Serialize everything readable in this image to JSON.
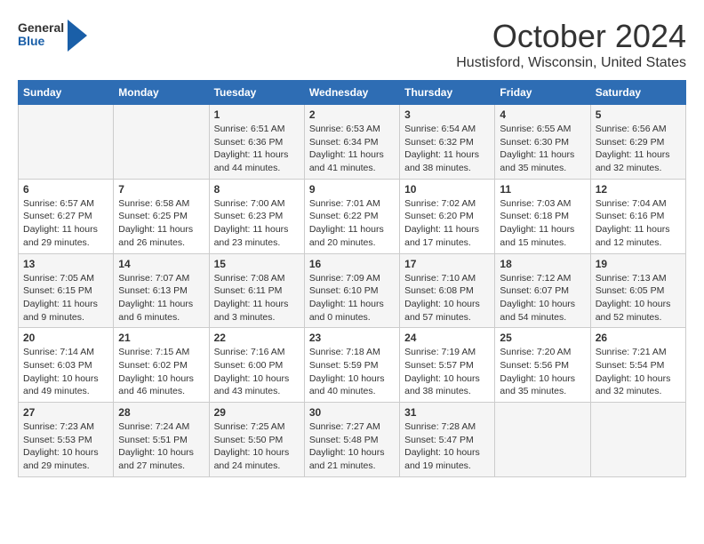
{
  "header": {
    "logo_general": "General",
    "logo_blue": "Blue",
    "title": "October 2024",
    "location": "Hustisford, Wisconsin, United States"
  },
  "days_of_week": [
    "Sunday",
    "Monday",
    "Tuesday",
    "Wednesday",
    "Thursday",
    "Friday",
    "Saturday"
  ],
  "weeks": [
    [
      {
        "num": "",
        "content": ""
      },
      {
        "num": "",
        "content": ""
      },
      {
        "num": "1",
        "content": "Sunrise: 6:51 AM\nSunset: 6:36 PM\nDaylight: 11 hours and 44 minutes."
      },
      {
        "num": "2",
        "content": "Sunrise: 6:53 AM\nSunset: 6:34 PM\nDaylight: 11 hours and 41 minutes."
      },
      {
        "num": "3",
        "content": "Sunrise: 6:54 AM\nSunset: 6:32 PM\nDaylight: 11 hours and 38 minutes."
      },
      {
        "num": "4",
        "content": "Sunrise: 6:55 AM\nSunset: 6:30 PM\nDaylight: 11 hours and 35 minutes."
      },
      {
        "num": "5",
        "content": "Sunrise: 6:56 AM\nSunset: 6:29 PM\nDaylight: 11 hours and 32 minutes."
      }
    ],
    [
      {
        "num": "6",
        "content": "Sunrise: 6:57 AM\nSunset: 6:27 PM\nDaylight: 11 hours and 29 minutes."
      },
      {
        "num": "7",
        "content": "Sunrise: 6:58 AM\nSunset: 6:25 PM\nDaylight: 11 hours and 26 minutes."
      },
      {
        "num": "8",
        "content": "Sunrise: 7:00 AM\nSunset: 6:23 PM\nDaylight: 11 hours and 23 minutes."
      },
      {
        "num": "9",
        "content": "Sunrise: 7:01 AM\nSunset: 6:22 PM\nDaylight: 11 hours and 20 minutes."
      },
      {
        "num": "10",
        "content": "Sunrise: 7:02 AM\nSunset: 6:20 PM\nDaylight: 11 hours and 17 minutes."
      },
      {
        "num": "11",
        "content": "Sunrise: 7:03 AM\nSunset: 6:18 PM\nDaylight: 11 hours and 15 minutes."
      },
      {
        "num": "12",
        "content": "Sunrise: 7:04 AM\nSunset: 6:16 PM\nDaylight: 11 hours and 12 minutes."
      }
    ],
    [
      {
        "num": "13",
        "content": "Sunrise: 7:05 AM\nSunset: 6:15 PM\nDaylight: 11 hours and 9 minutes."
      },
      {
        "num": "14",
        "content": "Sunrise: 7:07 AM\nSunset: 6:13 PM\nDaylight: 11 hours and 6 minutes."
      },
      {
        "num": "15",
        "content": "Sunrise: 7:08 AM\nSunset: 6:11 PM\nDaylight: 11 hours and 3 minutes."
      },
      {
        "num": "16",
        "content": "Sunrise: 7:09 AM\nSunset: 6:10 PM\nDaylight: 11 hours and 0 minutes."
      },
      {
        "num": "17",
        "content": "Sunrise: 7:10 AM\nSunset: 6:08 PM\nDaylight: 10 hours and 57 minutes."
      },
      {
        "num": "18",
        "content": "Sunrise: 7:12 AM\nSunset: 6:07 PM\nDaylight: 10 hours and 54 minutes."
      },
      {
        "num": "19",
        "content": "Sunrise: 7:13 AM\nSunset: 6:05 PM\nDaylight: 10 hours and 52 minutes."
      }
    ],
    [
      {
        "num": "20",
        "content": "Sunrise: 7:14 AM\nSunset: 6:03 PM\nDaylight: 10 hours and 49 minutes."
      },
      {
        "num": "21",
        "content": "Sunrise: 7:15 AM\nSunset: 6:02 PM\nDaylight: 10 hours and 46 minutes."
      },
      {
        "num": "22",
        "content": "Sunrise: 7:16 AM\nSunset: 6:00 PM\nDaylight: 10 hours and 43 minutes."
      },
      {
        "num": "23",
        "content": "Sunrise: 7:18 AM\nSunset: 5:59 PM\nDaylight: 10 hours and 40 minutes."
      },
      {
        "num": "24",
        "content": "Sunrise: 7:19 AM\nSunset: 5:57 PM\nDaylight: 10 hours and 38 minutes."
      },
      {
        "num": "25",
        "content": "Sunrise: 7:20 AM\nSunset: 5:56 PM\nDaylight: 10 hours and 35 minutes."
      },
      {
        "num": "26",
        "content": "Sunrise: 7:21 AM\nSunset: 5:54 PM\nDaylight: 10 hours and 32 minutes."
      }
    ],
    [
      {
        "num": "27",
        "content": "Sunrise: 7:23 AM\nSunset: 5:53 PM\nDaylight: 10 hours and 29 minutes."
      },
      {
        "num": "28",
        "content": "Sunrise: 7:24 AM\nSunset: 5:51 PM\nDaylight: 10 hours and 27 minutes."
      },
      {
        "num": "29",
        "content": "Sunrise: 7:25 AM\nSunset: 5:50 PM\nDaylight: 10 hours and 24 minutes."
      },
      {
        "num": "30",
        "content": "Sunrise: 7:27 AM\nSunset: 5:48 PM\nDaylight: 10 hours and 21 minutes."
      },
      {
        "num": "31",
        "content": "Sunrise: 7:28 AM\nSunset: 5:47 PM\nDaylight: 10 hours and 19 minutes."
      },
      {
        "num": "",
        "content": ""
      },
      {
        "num": "",
        "content": ""
      }
    ]
  ]
}
